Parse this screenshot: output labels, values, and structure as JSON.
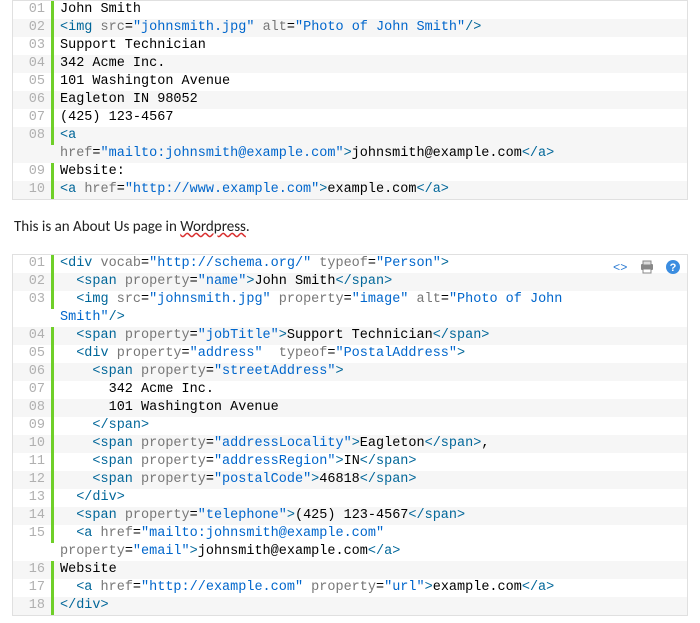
{
  "block1": {
    "lines": [
      {
        "n": "01",
        "html": "<span class='tx'>John Smith</span>"
      },
      {
        "n": "02",
        "html": "<span class='t'>&lt;img</span> <span class='a'>src</span>=<span class='s'>\"johnsmith.jpg\"</span> <span class='a'>alt</span>=<span class='s'>\"Photo of John Smith\"</span><span class='t'>/&gt;</span>"
      },
      {
        "n": "03",
        "html": "<span class='tx'>Support Technician</span>"
      },
      {
        "n": "04",
        "html": "<span class='tx'>342 Acme Inc.</span>"
      },
      {
        "n": "05",
        "html": "<span class='tx'>101 Washington Avenue</span>"
      },
      {
        "n": "06",
        "html": "<span class='tx'>Eagleton IN 98052</span>"
      },
      {
        "n": "07",
        "html": "<span class='tx'>(425) 123-4567</span>"
      },
      {
        "n": "08",
        "html": "<span class='t'>&lt;a</span>\n<span class='a'>href</span>=<span class='s'>\"mailto:johnsmith@example.com\"</span><span class='t'>&gt;</span><span class='tx'>johnsmith@example.com</span><span class='t'>&lt;/a&gt;</span>"
      },
      {
        "n": "09",
        "html": "<span class='tx'>Website:</span>"
      },
      {
        "n": "10",
        "html": "<span class='t'>&lt;a</span> <span class='a'>href</span>=<span class='s'>\"http://www.example.com\"</span><span class='t'>&gt;</span><span class='tx'>example.com</span><span class='t'>&lt;/a&gt;</span>"
      }
    ]
  },
  "caption": {
    "before": "This is an About Us page in ",
    "underlined": "Wordpress",
    "after": "."
  },
  "block2": {
    "lines": [
      {
        "n": "01",
        "html": "<span class='t'>&lt;div</span> <span class='a'>vocab</span>=<span class='s'>\"http://schema.org/\"</span> <span class='a'>typeof</span>=<span class='s'>\"Person\"</span><span class='t'>&gt;</span>"
      },
      {
        "n": "02",
        "html": "  <span class='t'>&lt;span</span> <span class='a'>property</span>=<span class='s'>\"name\"</span><span class='t'>&gt;</span><span class='tx'>John Smith</span><span class='t'>&lt;/span&gt;</span>"
      },
      {
        "n": "03",
        "html": "  <span class='t'>&lt;img</span> <span class='a'>src</span>=<span class='s'>\"johnsmith.jpg\"</span> <span class='a'>property</span>=<span class='s'>\"image\"</span> <span class='a'>alt</span>=<span class='s'>\"Photo of John\nSmith\"</span><span class='t'>/&gt;</span>"
      },
      {
        "n": "04",
        "html": "  <span class='t'>&lt;span</span> <span class='a'>property</span>=<span class='s'>\"jobTitle\"</span><span class='t'>&gt;</span><span class='tx'>Support Technician</span><span class='t'>&lt;/span&gt;</span>"
      },
      {
        "n": "05",
        "html": "  <span class='t'>&lt;div</span> <span class='a'>property</span>=<span class='s'>\"address\"</span>  <span class='a'>typeof</span>=<span class='s'>\"PostalAddress\"</span><span class='t'>&gt;</span>"
      },
      {
        "n": "06",
        "html": "    <span class='t'>&lt;span</span> <span class='a'>property</span>=<span class='s'>\"streetAddress\"</span><span class='t'>&gt;</span>"
      },
      {
        "n": "07",
        "html": "<span class='tx'>      342 Acme Inc.</span>"
      },
      {
        "n": "08",
        "html": "<span class='tx'>      101 Washington Avenue</span>"
      },
      {
        "n": "09",
        "html": "    <span class='t'>&lt;/span&gt;</span>"
      },
      {
        "n": "10",
        "html": "    <span class='t'>&lt;span</span> <span class='a'>property</span>=<span class='s'>\"addressLocality\"</span><span class='t'>&gt;</span><span class='tx'>Eagleton</span><span class='t'>&lt;/span&gt;</span><span class='tx'>,</span>"
      },
      {
        "n": "11",
        "html": "    <span class='t'>&lt;span</span> <span class='a'>property</span>=<span class='s'>\"addressRegion\"</span><span class='t'>&gt;</span><span class='tx'>IN</span><span class='t'>&lt;/span&gt;</span>"
      },
      {
        "n": "12",
        "html": "    <span class='t'>&lt;span</span> <span class='a'>property</span>=<span class='s'>\"postalCode\"</span><span class='t'>&gt;</span><span class='tx'>46818</span><span class='t'>&lt;/span&gt;</span>"
      },
      {
        "n": "13",
        "html": "  <span class='t'>&lt;/div&gt;</span>"
      },
      {
        "n": "14",
        "html": "  <span class='t'>&lt;span</span> <span class='a'>property</span>=<span class='s'>\"telephone\"</span><span class='t'>&gt;</span><span class='tx'>(425) 123-4567</span><span class='t'>&lt;/span&gt;</span>"
      },
      {
        "n": "15",
        "html": "  <span class='t'>&lt;a</span> <span class='a'>href</span>=<span class='s'>\"mailto:johnsmith@example.com\"</span>\n<span class='a'>property</span>=<span class='s'>\"email\"</span><span class='t'>&gt;</span><span class='tx'>johnsmith@example.com</span><span class='t'>&lt;/a&gt;</span>"
      },
      {
        "n": "16",
        "html": "<span class='tx'>Website</span>"
      },
      {
        "n": "17",
        "html": "  <span class='t'>&lt;a</span> <span class='a'>href</span>=<span class='s'>\"http://example.com\"</span> <span class='a'>property</span>=<span class='s'>\"url\"</span><span class='t'>&gt;</span><span class='tx'>example.com</span><span class='t'>&lt;/a&gt;</span>"
      },
      {
        "n": "18",
        "html": "<span class='t'>&lt;/div&gt;</span>"
      }
    ]
  },
  "toolbar": {
    "view_source": "view-source-icon",
    "print": "print-icon",
    "help": "help-icon"
  }
}
